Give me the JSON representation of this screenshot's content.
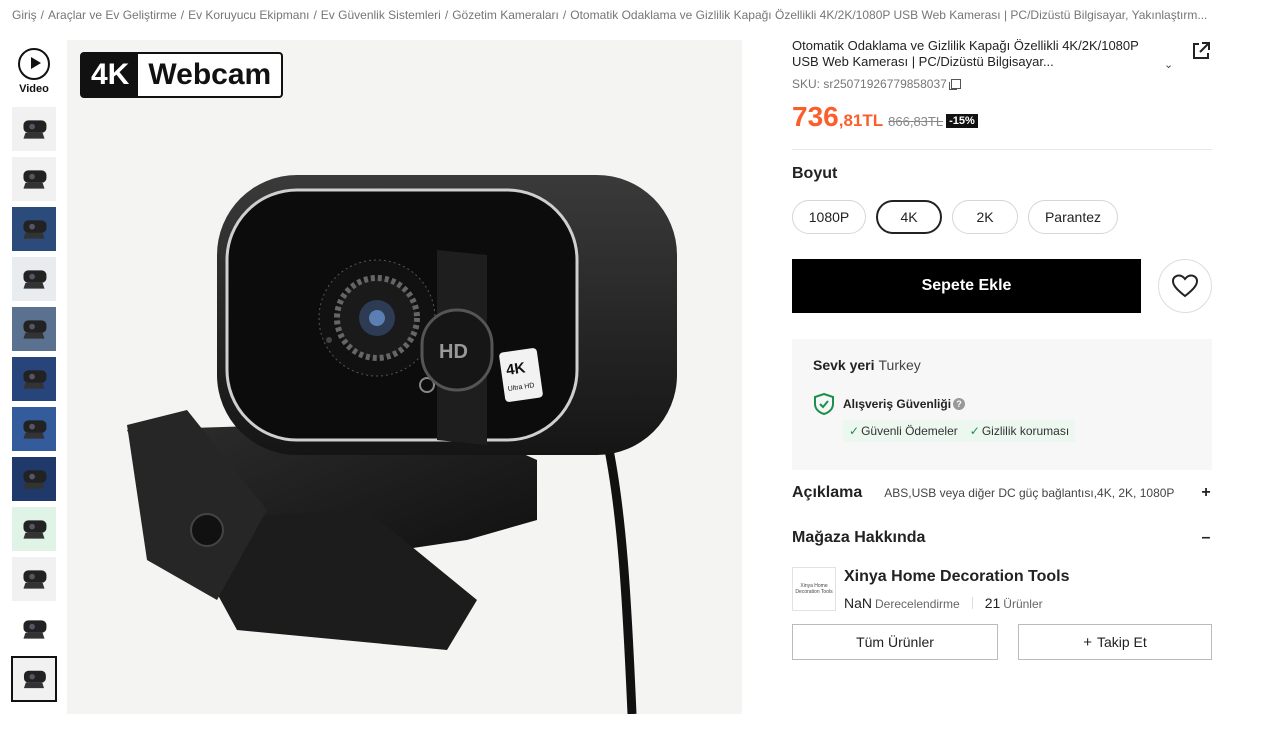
{
  "breadcrumb": [
    "Giriş",
    "Araçlar ve Ev Geliştirme",
    "Ev Koruyucu Ekipmanı",
    "Ev Güvenlik Sistemleri",
    "Gözetim Kameraları",
    "Otomatik Odaklama ve Gizlilik Kapağı Özellikli 4K/2K/1080P USB Web Kamerası | PC/Dizüstü Bilgisayar, Yakınlaştırm..."
  ],
  "gallery": {
    "video_label": "Video",
    "thumbnail_count": 12,
    "active_thumbnail": 11,
    "badge_part1": "4K",
    "badge_part2": "Webcam"
  },
  "product": {
    "title": "Otomatik Odaklama ve Gizlilik Kapağı Özellikli 4K/2K/1080P USB Web Kamerası | PC/Dizüstü Bilgisayar...",
    "sku": "SKU: sr25071926779858037",
    "price_int": "736",
    "price_dec": ",81",
    "price_currency": "TL",
    "old_price": "866,83TL",
    "discount": "-15%",
    "price_color": "#fb5e2a"
  },
  "size": {
    "label": "Boyut",
    "options": [
      "1080P",
      "4K",
      "2K",
      "Parantez"
    ],
    "selected": "4K"
  },
  "actions": {
    "add_to_cart": "Sepete Ekle"
  },
  "shipping": {
    "label": "Sevk yeri",
    "value": "Turkey",
    "security_title": "Alışveriş Güvenliği",
    "help": "?",
    "tags": [
      "Güvenli Ödemeler",
      "Gizlilik koruması"
    ]
  },
  "description": {
    "title": "Açıklama",
    "summary": "ABS,USB veya diğer DC güç bağlantısı,4K, 2K, 1080P",
    "toggle": "+"
  },
  "store": {
    "title": "Mağaza Hakkında",
    "toggle": "–",
    "logo_text": "Xinya Home Decoration Tools",
    "name": "Xinya Home Decoration Tools",
    "rating_value": "NaN",
    "rating_label": "Derecelendirme",
    "product_count": "21",
    "product_label": "Ürünler",
    "all_products_button": "Tüm Ürünler",
    "follow_button": "Takip Et"
  }
}
